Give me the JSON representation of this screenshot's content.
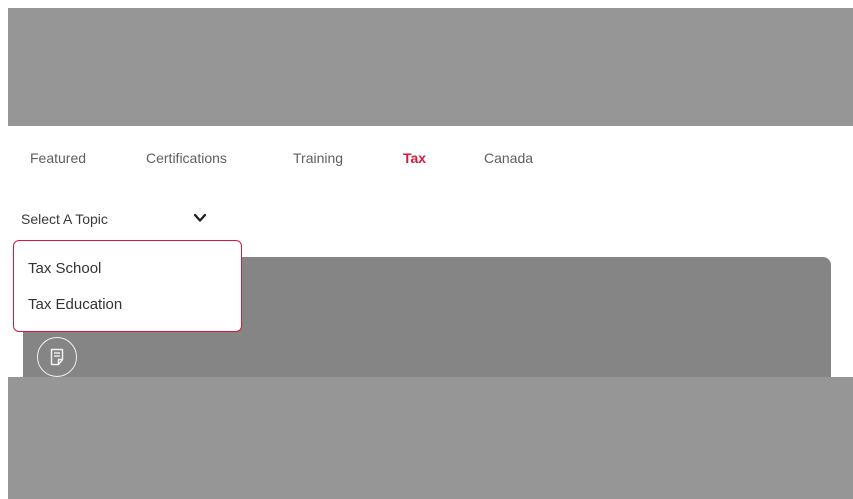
{
  "tabs": [
    {
      "label": "Featured"
    },
    {
      "label": "Certifications"
    },
    {
      "label": "Training"
    },
    {
      "label": "Tax",
      "active": true
    },
    {
      "label": "Canada"
    }
  ],
  "topic_select": {
    "label": "Select A Topic",
    "icon": "chevron-down-icon"
  },
  "dropdown": {
    "options": [
      {
        "label": "Tax School"
      },
      {
        "label": "Tax Education"
      }
    ]
  },
  "card": {
    "icon": "document-icon"
  },
  "colors": {
    "accent": "#d5193f",
    "overlay": "#969696",
    "card": "#858585",
    "text": "#5f5f5f"
  }
}
